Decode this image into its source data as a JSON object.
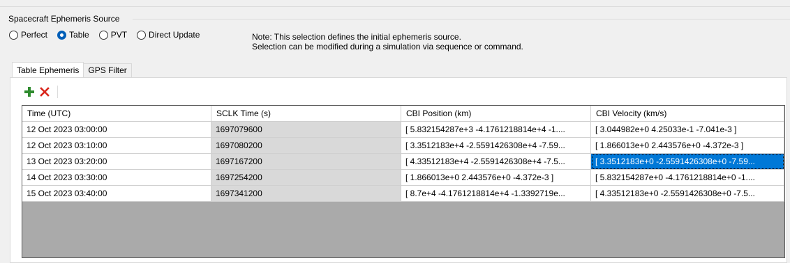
{
  "group": {
    "title": "Spacecraft Ephemeris Source"
  },
  "source_options": [
    {
      "label": "Perfect",
      "checked": false
    },
    {
      "label": "Table",
      "checked": true
    },
    {
      "label": "PVT",
      "checked": false
    },
    {
      "label": "Direct Update",
      "checked": false
    }
  ],
  "note": {
    "line1": "Note: This selection defines the initial ephemeris source.",
    "line2": "Selection can be modified during a simulation via sequence or command."
  },
  "tabs": [
    {
      "label": "Table Ephemeris",
      "active": true
    },
    {
      "label": "GPS Filter",
      "active": false
    }
  ],
  "toolbar": {
    "add_icon": "plus-icon",
    "delete_icon": "close-icon",
    "add_color": "#2e8b2e",
    "delete_color": "#d9261c"
  },
  "table": {
    "columns": [
      "Time (UTC)",
      "SCLK Time (s)",
      "CBI Position (km)",
      "CBI Velocity (km/s)"
    ],
    "rows": [
      [
        "12 Oct 2023 03:00:00",
        "1697079600",
        "[ 5.832154287e+3  -4.1761218814e+4  -1....",
        "[ 3.044982e+0  4.25033e-1  -7.041e-3 ]"
      ],
      [
        "12 Oct 2023 03:10:00",
        "1697080200",
        "[ 3.3512183e+4  -2.5591426308e+4  -7.59...",
        "[ 1.866013e+0  2.443576e+0  -4.372e-3 ]"
      ],
      [
        "13 Oct 2023 03:20:00",
        "1697167200",
        "[ 4.33512183e+4  -2.5591426308e+4  -7.5...",
        "[ 3.3512183e+0  -2.5591426308e+0  -7.59..."
      ],
      [
        "14 Oct 2023 03:30:00",
        "1697254200",
        "[ 1.866013e+0  2.443576e+0  -4.372e-3 ]",
        "[ 5.832154287e+0  -4.1761218814e+0  -1...."
      ],
      [
        "15 Oct 2023 03:40:00",
        "1697341200",
        "[ 8.7e+4  -4.1761218814e+4  -1.3392719e...",
        "[ 4.33512183e+0  -2.5591426308e+0  -7.5..."
      ]
    ],
    "selected_cell": {
      "row": 2,
      "col": 3
    }
  },
  "colors": {
    "selection": "#0078d7",
    "readonly_cell": "#d9d9d9",
    "grid_empty": "#aaaaaa"
  }
}
